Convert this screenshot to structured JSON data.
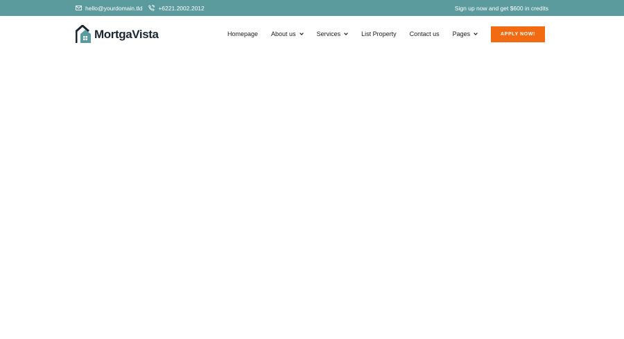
{
  "colors": {
    "topbar_bg": "#5b9a9d",
    "cta_bg": "#f26a12",
    "logo_dark": "#1c2733",
    "logo_teal": "#5b9a9d"
  },
  "topbar": {
    "email": "hello@yourdomain.tld",
    "email_icon": "envelope-icon",
    "phone": "+6221.2002.2012",
    "phone_icon": "phone-icon",
    "promo": "Sign up now and get $600 in credits"
  },
  "header": {
    "logo_text": "MortgaVista",
    "logo_icon": "house-logo-icon",
    "nav": [
      {
        "label": "Homepage",
        "has_dropdown": false
      },
      {
        "label": "About us",
        "has_dropdown": true
      },
      {
        "label": "Services",
        "has_dropdown": true
      },
      {
        "label": "List Property",
        "has_dropdown": false
      },
      {
        "label": "Contact us",
        "has_dropdown": false
      },
      {
        "label": "Pages",
        "has_dropdown": true
      }
    ],
    "cta_label": "APPLY NOW!"
  }
}
